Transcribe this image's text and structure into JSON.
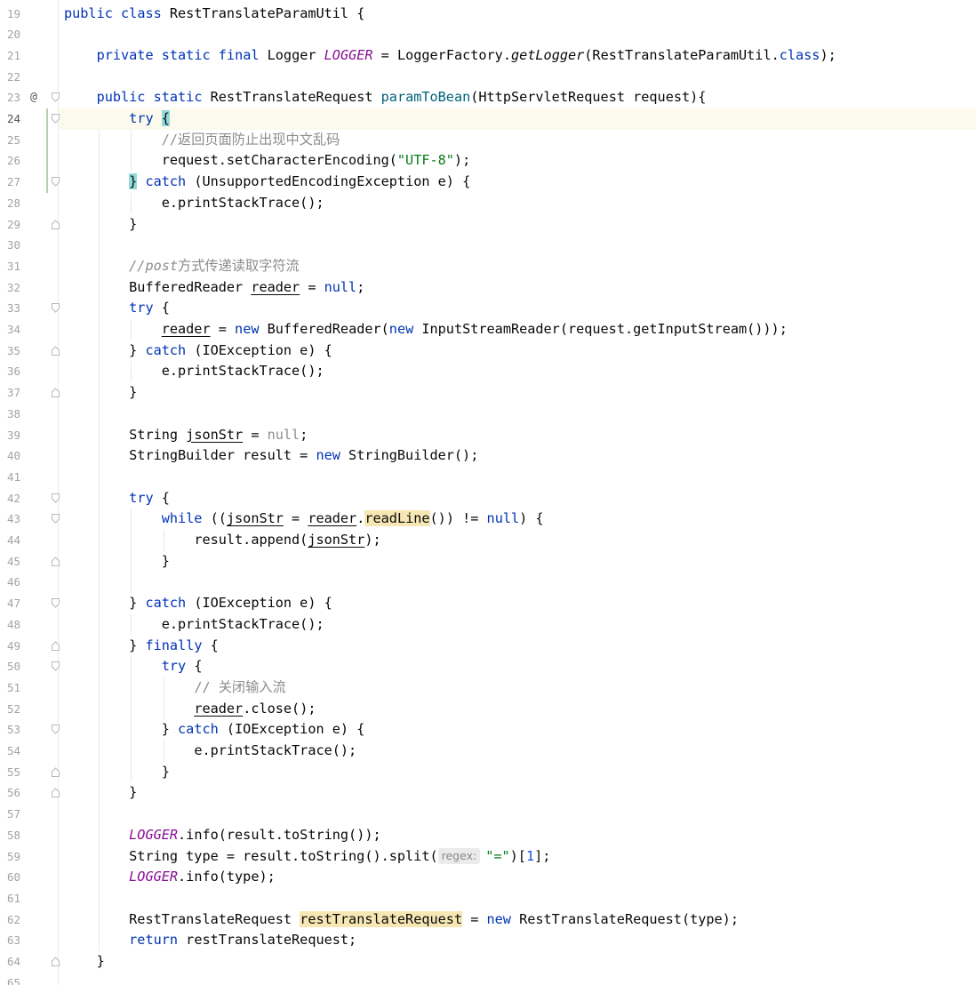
{
  "editor": {
    "current_line": "24",
    "colors": {
      "keyword": "#0033b3",
      "string": "#067d17",
      "comment": "#8c8c8c",
      "static_field": "#871094",
      "method_decl": "#00627a",
      "number": "#1750eb",
      "usage_highlight": "#f6e7b4",
      "brace_match": "#93d9d9",
      "current_line_bg": "#fcfaed"
    },
    "icons": [
      "override-marker-icon",
      "fold-open-icon",
      "fold-close-icon"
    ],
    "lines": [
      {
        "n": "19",
        "indent": 0,
        "tokens": [
          {
            "t": "public",
            "c": "kw"
          },
          {
            "t": " "
          },
          {
            "t": "class",
            "c": "kw"
          },
          {
            "t": " RestTranslateParamUtil {"
          }
        ]
      },
      {
        "n": "20",
        "indent": 0,
        "tokens": []
      },
      {
        "n": "21",
        "indent": 1,
        "tokens": [
          {
            "t": "private",
            "c": "kw"
          },
          {
            "t": " "
          },
          {
            "t": "static",
            "c": "kw"
          },
          {
            "t": " "
          },
          {
            "t": "final",
            "c": "kw"
          },
          {
            "t": " Logger "
          },
          {
            "t": "LOGGER",
            "c": "sf"
          },
          {
            "t": " = LoggerFactory."
          },
          {
            "t": "getLogger",
            "c": "ital"
          },
          {
            "t": "(RestTranslateParamUtil."
          },
          {
            "t": "class",
            "c": "kw"
          },
          {
            "t": ");"
          }
        ]
      },
      {
        "n": "22",
        "indent": 0,
        "tokens": []
      },
      {
        "n": "23",
        "indent": 1,
        "marker": "@",
        "fold": "open",
        "tokens": [
          {
            "t": "public",
            "c": "kw"
          },
          {
            "t": " "
          },
          {
            "t": "static",
            "c": "kw"
          },
          {
            "t": " RestTranslateRequest "
          },
          {
            "t": "paramToBean",
            "c": "mcall"
          },
          {
            "t": "(HttpServletRequest request){"
          }
        ]
      },
      {
        "n": "24",
        "indent": 2,
        "fold": "open",
        "tokens": [
          {
            "t": "try",
            "c": "kw"
          },
          {
            "t": " "
          },
          {
            "t": "{",
            "c": "hl-brace"
          }
        ]
      },
      {
        "n": "25",
        "indent": 3,
        "tokens": [
          {
            "t": "//返回页面防止出现中文乱码",
            "c": "cmtn"
          }
        ]
      },
      {
        "n": "26",
        "indent": 3,
        "tokens": [
          {
            "t": "request.setCharacterEncoding("
          },
          {
            "t": "\"UTF-8\"",
            "c": "str"
          },
          {
            "t": ");"
          }
        ]
      },
      {
        "n": "27",
        "indent": 2,
        "fold": "open",
        "tokens": [
          {
            "t": "}",
            "c": "hl-brace"
          },
          {
            "t": " "
          },
          {
            "t": "catch",
            "c": "kw"
          },
          {
            "t": " (UnsupportedEncodingException e) {"
          }
        ]
      },
      {
        "n": "28",
        "indent": 3,
        "tokens": [
          {
            "t": "e.printStackTrace();"
          }
        ]
      },
      {
        "n": "29",
        "indent": 2,
        "fold": "close",
        "tokens": [
          {
            "t": "}"
          }
        ]
      },
      {
        "n": "30",
        "indent": 0,
        "tokens": []
      },
      {
        "n": "31",
        "indent": 2,
        "tokens": [
          {
            "t": "//post",
            "c": "cmt"
          },
          {
            "t": "方式传递读取字符流",
            "c": "cmtn"
          }
        ]
      },
      {
        "n": "32",
        "indent": 2,
        "tokens": [
          {
            "t": "BufferedReader "
          },
          {
            "t": "reader",
            "c": "ul"
          },
          {
            "t": " = "
          },
          {
            "t": "null",
            "c": "kw"
          },
          {
            "t": ";"
          }
        ]
      },
      {
        "n": "33",
        "indent": 2,
        "fold": "open",
        "tokens": [
          {
            "t": "try",
            "c": "kw"
          },
          {
            "t": " {"
          }
        ]
      },
      {
        "n": "34",
        "indent": 3,
        "tokens": [
          {
            "t": "reader",
            "c": "ul"
          },
          {
            "t": " = "
          },
          {
            "t": "new",
            "c": "kw"
          },
          {
            "t": " BufferedReader("
          },
          {
            "t": "new",
            "c": "kw"
          },
          {
            "t": " InputStreamReader(request.getInputStream()));"
          }
        ]
      },
      {
        "n": "35",
        "indent": 2,
        "fold": "close",
        "tokens": [
          {
            "t": "} "
          },
          {
            "t": "catch",
            "c": "kw"
          },
          {
            "t": " (IOException e) {"
          }
        ]
      },
      {
        "n": "36",
        "indent": 3,
        "tokens": [
          {
            "t": "e.printStackTrace();"
          }
        ]
      },
      {
        "n": "37",
        "indent": 2,
        "fold": "close",
        "tokens": [
          {
            "t": "}"
          }
        ]
      },
      {
        "n": "38",
        "indent": 0,
        "tokens": []
      },
      {
        "n": "39",
        "indent": 2,
        "tokens": [
          {
            "t": "String "
          },
          {
            "t": "jsonStr",
            "c": "ul"
          },
          {
            "t": " = "
          },
          {
            "t": "null",
            "c": "nul"
          },
          {
            "t": ";"
          }
        ]
      },
      {
        "n": "40",
        "indent": 2,
        "tokens": [
          {
            "t": "StringBuilder result = "
          },
          {
            "t": "new",
            "c": "kw"
          },
          {
            "t": " StringBuilder();"
          }
        ]
      },
      {
        "n": "41",
        "indent": 0,
        "tokens": []
      },
      {
        "n": "42",
        "indent": 2,
        "fold": "open",
        "tokens": [
          {
            "t": "try",
            "c": "kw"
          },
          {
            "t": " {"
          }
        ]
      },
      {
        "n": "43",
        "indent": 3,
        "fold": "open",
        "tokens": [
          {
            "t": "while",
            "c": "kw"
          },
          {
            "t": " (("
          },
          {
            "t": "jsonStr",
            "c": "ul"
          },
          {
            "t": " = "
          },
          {
            "t": "reader",
            "c": "ul"
          },
          {
            "t": "."
          },
          {
            "t": "readLine",
            "c": "hl-use"
          },
          {
            "t": "()) != "
          },
          {
            "t": "null",
            "c": "kw"
          },
          {
            "t": ") {"
          }
        ]
      },
      {
        "n": "44",
        "indent": 4,
        "tokens": [
          {
            "t": "result.append("
          },
          {
            "t": "jsonStr",
            "c": "ul"
          },
          {
            "t": ");"
          }
        ]
      },
      {
        "n": "45",
        "indent": 3,
        "fold": "close",
        "tokens": [
          {
            "t": "}"
          }
        ]
      },
      {
        "n": "46",
        "indent": 0,
        "tokens": []
      },
      {
        "n": "47",
        "indent": 2,
        "fold": "open",
        "tokens": [
          {
            "t": "} "
          },
          {
            "t": "catch",
            "c": "kw"
          },
          {
            "t": " (IOException e) {"
          }
        ]
      },
      {
        "n": "48",
        "indent": 3,
        "tokens": [
          {
            "t": "e.printStackTrace();"
          }
        ]
      },
      {
        "n": "49",
        "indent": 2,
        "fold": "close",
        "tokens": [
          {
            "t": "} "
          },
          {
            "t": "finally",
            "c": "kw"
          },
          {
            "t": " {"
          }
        ]
      },
      {
        "n": "50",
        "indent": 3,
        "fold": "open",
        "tokens": [
          {
            "t": "try",
            "c": "kw"
          },
          {
            "t": " {"
          }
        ]
      },
      {
        "n": "51",
        "indent": 4,
        "tokens": [
          {
            "t": "// 关闭输入流",
            "c": "cmtn"
          }
        ]
      },
      {
        "n": "52",
        "indent": 4,
        "tokens": [
          {
            "t": "reader",
            "c": "ul"
          },
          {
            "t": ".close();"
          }
        ]
      },
      {
        "n": "53",
        "indent": 3,
        "fold": "open",
        "tokens": [
          {
            "t": "} "
          },
          {
            "t": "catch",
            "c": "kw"
          },
          {
            "t": " (IOException e) {"
          }
        ]
      },
      {
        "n": "54",
        "indent": 4,
        "tokens": [
          {
            "t": "e.printStackTrace();"
          }
        ]
      },
      {
        "n": "55",
        "indent": 3,
        "fold": "close",
        "tokens": [
          {
            "t": "}"
          }
        ]
      },
      {
        "n": "56",
        "indent": 2,
        "fold": "close",
        "tokens": [
          {
            "t": "}"
          }
        ]
      },
      {
        "n": "57",
        "indent": 0,
        "tokens": []
      },
      {
        "n": "58",
        "indent": 2,
        "tokens": [
          {
            "t": "LOGGER",
            "c": "sf"
          },
          {
            "t": ".info(result.toString());"
          }
        ]
      },
      {
        "n": "59",
        "indent": 2,
        "tokens": [
          {
            "t": "String type = result.toString().split("
          },
          {
            "t": "regex:",
            "c": "hint"
          },
          {
            "t": "\"=\"",
            "c": "str"
          },
          {
            "t": ")["
          },
          {
            "t": "1",
            "c": "num-lit"
          },
          {
            "t": "];"
          }
        ]
      },
      {
        "n": "60",
        "indent": 2,
        "tokens": [
          {
            "t": "LOGGER",
            "c": "sf"
          },
          {
            "t": ".info(type);"
          }
        ]
      },
      {
        "n": "61",
        "indent": 0,
        "tokens": []
      },
      {
        "n": "62",
        "indent": 2,
        "tokens": [
          {
            "t": "RestTranslateRequest "
          },
          {
            "t": "restTranslateRequest",
            "c": "hl-use"
          },
          {
            "t": " = "
          },
          {
            "t": "new",
            "c": "kw"
          },
          {
            "t": " RestTranslateRequest(type);"
          }
        ]
      },
      {
        "n": "63",
        "indent": 2,
        "tokens": [
          {
            "t": "return",
            "c": "kw"
          },
          {
            "t": " restTranslateRequest;"
          }
        ]
      },
      {
        "n": "64",
        "indent": 1,
        "fold": "close",
        "tokens": [
          {
            "t": "}"
          }
        ]
      },
      {
        "n": "65",
        "indent": 0,
        "tokens": []
      }
    ]
  }
}
